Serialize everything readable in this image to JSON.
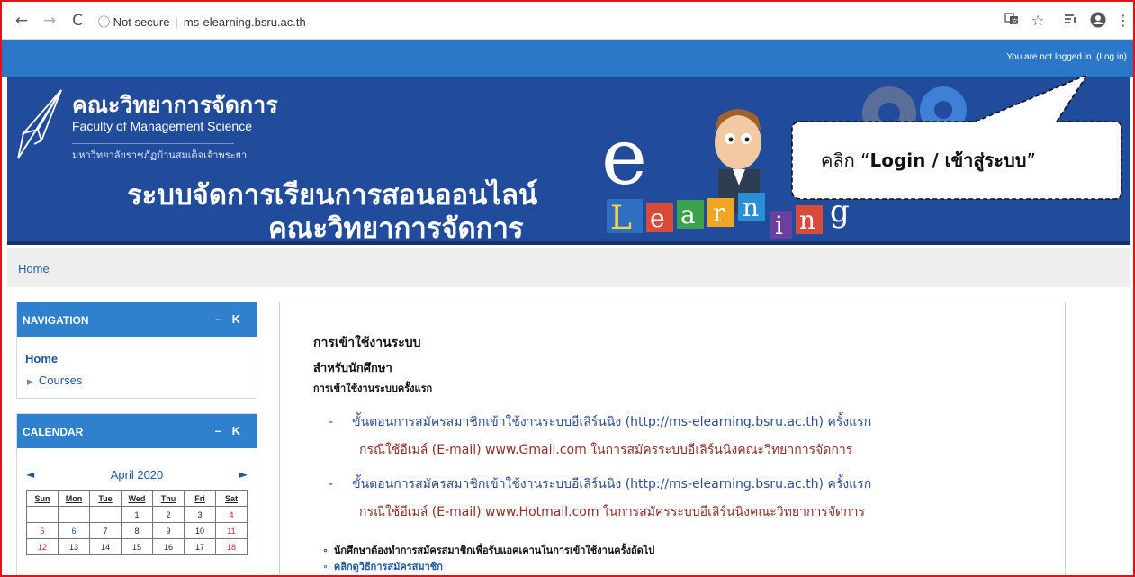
{
  "browser": {
    "security": "ⓘ Not secure",
    "url": "ms-elearning.bsru.ac.th"
  },
  "topbar": {
    "login_info": "You are not logged in. (Log in)"
  },
  "banner": {
    "faculty_th": "คณะวิทยาการจัดการ",
    "faculty_en": "Faculty of Management Science",
    "university_th": "มหาวิทยาลัยราชภัฏบ้านสมเด็จเจ้าพระยา",
    "system_line1": "ระบบจัดการเรียนการสอนออนไลน์",
    "system_line2": "คณะวิทยาการจัดการ",
    "art_letters": [
      "e",
      "L",
      "e",
      "a",
      "r",
      "n",
      "i",
      "n",
      "g"
    ]
  },
  "callout": {
    "prefix": "คลิก ",
    "quote_open": "“",
    "emphasis": "Login / เข้าสู่ระบบ",
    "quote_close": "”"
  },
  "breadcrumb": {
    "home": "Home"
  },
  "navigation": {
    "title": "NAVIGATION",
    "controls": "– K",
    "home": "Home",
    "courses": "Courses"
  },
  "calendar": {
    "title": "CALENDAR",
    "controls": "– K",
    "prev": "◄",
    "next": "►",
    "month": "April 2020",
    "days": [
      "Sun",
      "Mon",
      "Tue",
      "Wed",
      "Thu",
      "Fri",
      "Sat"
    ],
    "weeks": [
      [
        "",
        "",
        "",
        "1",
        "2",
        "3",
        "4"
      ],
      [
        "5",
        "6",
        "7",
        "8",
        "9",
        "10",
        "11"
      ],
      [
        "12",
        "13",
        "14",
        "15",
        "16",
        "17",
        "18"
      ]
    ]
  },
  "content": {
    "heading": "การเข้าใช้งานระบบ",
    "subheading": "สำหรับนักศึกษา",
    "caption": "การเข้าใช้งานระบบครั้งแรก",
    "steps": [
      {
        "dash": "-",
        "text": "ขั้นตอนการสมัครสมาชิกเข้าใช้งานระบบอีเลิร์นนิง (http://ms-elearning.bsru.ac.th) ครั้งแรก",
        "sub": "กรณีใช้อีเมล์ (E-mail) www.Gmail.com ในการสมัครระบบอีเลิร์นนิงคณะวิทยาการจัดการ"
      },
      {
        "dash": "-",
        "text": "ขั้นตอนการสมัครสมาชิกเข้าใช้งานระบบอีเลิร์นนิง (http://ms-elearning.bsru.ac.th) ครั้งแรก",
        "sub": "กรณีใช้อีเมล์ (E-mail) www.Hotmail.com ในการสมัครระบบอีเลิร์นนิงคณะวิทยาการจัดการ"
      }
    ],
    "bullets": [
      "นักศึกษาต้องทำการสมัครสมาชิกเพื่อรับแอคเคานในการเข้าใช้งานครั้งถัดไป",
      "คลิกดูวิธีการสมัครสมาชิก"
    ],
    "bullet_marker": "∘"
  },
  "colors": {
    "topbar": "#2b78c8",
    "banner": "#214b9b",
    "block_header": "#2f80cd",
    "link": "#1e56a0",
    "step_text": "#2d4f8f",
    "sub_text": "#8e2d26",
    "frame_border": "#e0121a"
  }
}
